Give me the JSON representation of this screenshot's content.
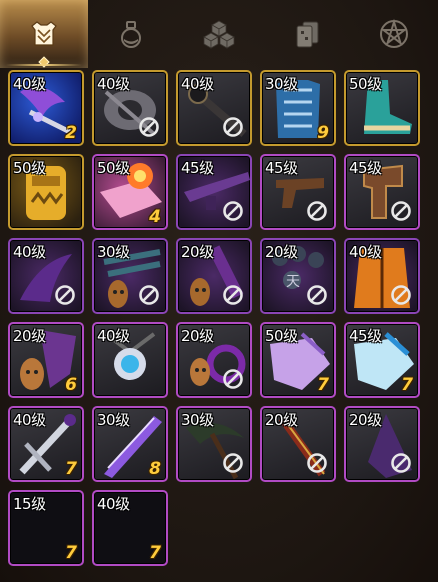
{
  "tabs": [
    {
      "name": "equipment-tab",
      "icon": "armor-icon",
      "active": true
    },
    {
      "name": "potion-tab",
      "icon": "potion-icon",
      "active": false
    },
    {
      "name": "material-tab",
      "icon": "cubes-icon",
      "active": false
    },
    {
      "name": "card-tab",
      "icon": "cards-icon",
      "active": false
    },
    {
      "name": "star-tab",
      "icon": "pentagram-icon",
      "active": false
    }
  ],
  "items": [
    {
      "level": "40级",
      "count": "2",
      "rarity": "gold",
      "banned": false,
      "art": "purple-wing-bow",
      "bg": "blue"
    },
    {
      "level": "40级",
      "count": "",
      "rarity": "gold",
      "banned": true,
      "art": "grey-axe",
      "bg": "dark"
    },
    {
      "level": "40级",
      "count": "",
      "rarity": "gold",
      "banned": true,
      "art": "dark-staff",
      "bg": "dark"
    },
    {
      "level": "30级",
      "count": "9",
      "rarity": "gold",
      "banned": false,
      "art": "blue-armor",
      "bg": "dark"
    },
    {
      "level": "50级",
      "count": "",
      "rarity": "gold",
      "banned": false,
      "art": "teal-boots",
      "bg": "dark"
    },
    {
      "level": "50级",
      "count": "",
      "rarity": "gold",
      "banned": false,
      "art": "golden-mask",
      "bg": "gold"
    },
    {
      "level": "50级",
      "count": "4",
      "rarity": "pink",
      "banned": false,
      "art": "pink-fire-book",
      "bg": "pinkwarm"
    },
    {
      "level": "45级",
      "count": "",
      "rarity": "purple",
      "banned": true,
      "art": "purple-rifle",
      "bg": "purple"
    },
    {
      "level": "45级",
      "count": "",
      "rarity": "pink",
      "banned": true,
      "art": "brown-pistol",
      "bg": "dark"
    },
    {
      "level": "45级",
      "count": "",
      "rarity": "pink",
      "banned": true,
      "art": "bronze-glove",
      "bg": "dark"
    },
    {
      "level": "40级",
      "count": "",
      "rarity": "purple",
      "banned": true,
      "art": "violet-claw",
      "bg": "purple"
    },
    {
      "level": "30级",
      "count": "",
      "rarity": "purple",
      "banned": true,
      "art": "idol-feathers",
      "bg": "purple"
    },
    {
      "level": "20级",
      "count": "",
      "rarity": "purple",
      "banned": true,
      "art": "idol-brush",
      "bg": "purple"
    },
    {
      "level": "20级",
      "count": "",
      "rarity": "purple",
      "banned": true,
      "art": "bead-necklace",
      "bg": "purple"
    },
    {
      "level": "40级",
      "count": "",
      "rarity": "purple",
      "banned": true,
      "art": "orange-robe",
      "bg": "purple"
    },
    {
      "level": "20级",
      "count": "6",
      "rarity": "pink",
      "banned": false,
      "art": "idol-shield",
      "bg": "dark"
    },
    {
      "level": "40级",
      "count": "",
      "rarity": "pink",
      "banned": false,
      "art": "blue-orb-amulet",
      "bg": "dark"
    },
    {
      "level": "20级",
      "count": "",
      "rarity": "pink",
      "banned": true,
      "art": "idol-ring",
      "bg": "dark"
    },
    {
      "level": "50级",
      "count": "7",
      "rarity": "pink",
      "banned": false,
      "art": "lavender-gloves",
      "bg": "dark"
    },
    {
      "level": "45级",
      "count": "7",
      "rarity": "pink",
      "banned": false,
      "art": "frost-gloves",
      "bg": "dark"
    },
    {
      "level": "40级",
      "count": "7",
      "rarity": "pink",
      "banned": false,
      "art": "silver-cross-sword",
      "bg": "dark"
    },
    {
      "level": "30级",
      "count": "8",
      "rarity": "pink",
      "banned": false,
      "art": "purple-blade",
      "bg": "dark"
    },
    {
      "level": "30级",
      "count": "",
      "rarity": "pink",
      "banned": true,
      "art": "green-scythe",
      "bg": "dark"
    },
    {
      "level": "20级",
      "count": "",
      "rarity": "pink",
      "banned": true,
      "art": "red-gold-spear",
      "bg": "dark"
    },
    {
      "level": "20级",
      "count": "",
      "rarity": "pink",
      "banned": true,
      "art": "purple-tassel",
      "bg": "dark"
    },
    {
      "level": "15级",
      "count": "7",
      "rarity": "pink",
      "banned": false,
      "art": "empty",
      "bg": "black"
    },
    {
      "level": "40级",
      "count": "7",
      "rarity": "pink",
      "banned": false,
      "art": "empty",
      "bg": "black"
    }
  ]
}
